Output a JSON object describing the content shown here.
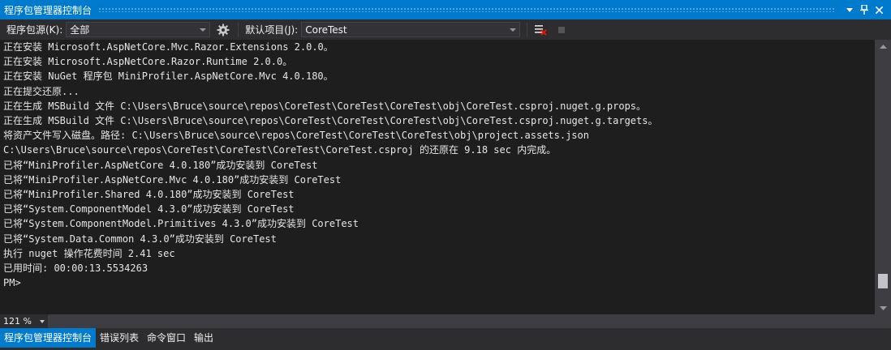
{
  "window": {
    "title": "程序包管理器控制台"
  },
  "toolbar": {
    "source_label": "程序包源(K):",
    "source_value": "全部",
    "project_label": "默认项目(J):",
    "project_value": "CoreTest"
  },
  "output": {
    "lines": [
      "正在安装 Microsoft.AspNetCore.Mvc.Razor.Extensions 2.0.0。",
      "正在安装 Microsoft.AspNetCore.Razor.Runtime 2.0.0。",
      "正在安装 NuGet 程序包 MiniProfiler.AspNetCore.Mvc 4.0.180。",
      "正在提交还原...",
      "正在生成 MSBuild 文件 C:\\Users\\Bruce\\source\\repos\\CoreTest\\CoreTest\\CoreTest\\obj\\CoreTest.csproj.nuget.g.props。",
      "正在生成 MSBuild 文件 C:\\Users\\Bruce\\source\\repos\\CoreTest\\CoreTest\\CoreTest\\obj\\CoreTest.csproj.nuget.g.targets。",
      "将资产文件写入磁盘。路径: C:\\Users\\Bruce\\source\\repos\\CoreTest\\CoreTest\\CoreTest\\obj\\project.assets.json",
      "C:\\Users\\Bruce\\source\\repos\\CoreTest\\CoreTest\\CoreTest\\CoreTest.csproj 的还原在 9.18 sec 内完成。",
      "已将“MiniProfiler.AspNetCore 4.0.180”成功安装到 CoreTest",
      "已将“MiniProfiler.AspNetCore.Mvc 4.0.180”成功安装到 CoreTest",
      "已将“MiniProfiler.Shared 4.0.180”成功安装到 CoreTest",
      "已将“System.ComponentModel 4.3.0”成功安装到 CoreTest",
      "已将“System.ComponentModel.Primitives 4.3.0”成功安装到 CoreTest",
      "已将“System.Data.Common 4.3.0”成功安装到 CoreTest",
      "执行 nuget 操作花费时间 2.41 sec",
      "已用时间: 00:00:13.5534263",
      "PM>"
    ]
  },
  "zoom": {
    "value": "121 %"
  },
  "tabs": [
    {
      "label": "程序包管理器控制台",
      "active": true
    },
    {
      "label": "错误列表",
      "active": false
    },
    {
      "label": "命令窗口",
      "active": false
    },
    {
      "label": "输出",
      "active": false
    }
  ],
  "icons": {
    "settings": "gear-icon",
    "clear": "clear-console-icon",
    "stop": "stop-icon",
    "dropdown": "chevron-down-icon",
    "pin": "pin-icon",
    "close": "close-icon"
  },
  "colors": {
    "accent": "#007acc",
    "background": "#1e1e1e",
    "chrome": "#2d2d30"
  }
}
